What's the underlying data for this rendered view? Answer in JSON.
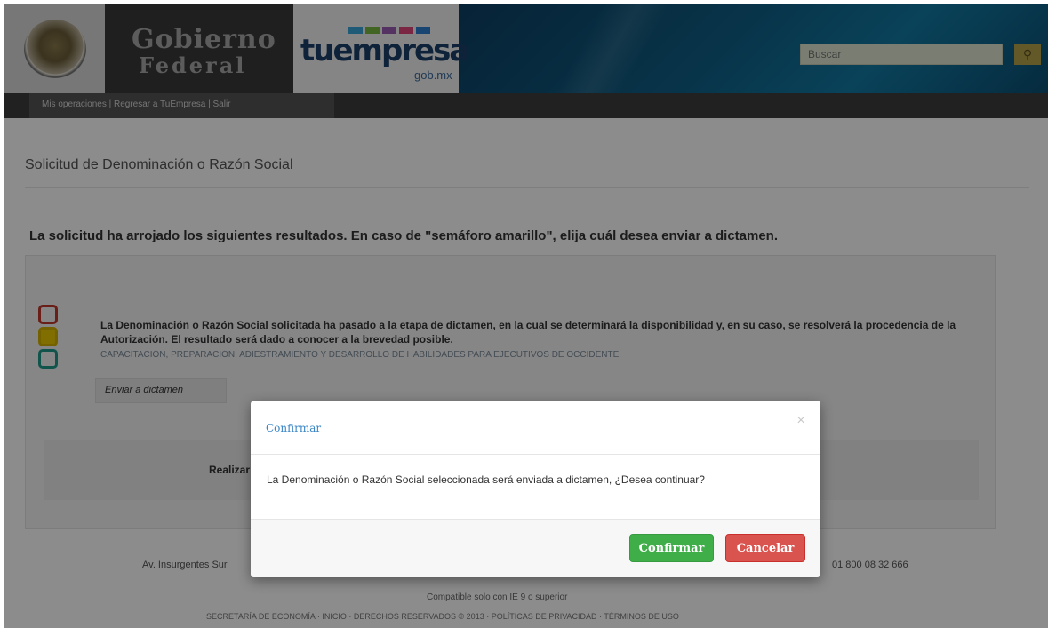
{
  "header": {
    "gobierno_line1": "Gobierno",
    "gobierno_line2": "Federal",
    "tuempresa_logo": "tuempresa",
    "tuempresa_sub": "gob.mx",
    "search_placeholder": "Buscar",
    "search_icon": "search-icon",
    "emblem_icon": "mexico-emblem-icon"
  },
  "nav": {
    "links": "Mis operaciones | Regresar a TuEmpresa | Salir"
  },
  "page": {
    "title": "Solicitud de Denominación o Razón Social",
    "heading": "La solicitud ha arrojado los siguientes resultados. En caso de \"semáforo amarillo\", elija cuál desea enviar a dictamen."
  },
  "result": {
    "message": "La Denominación o Razón Social solicitada ha pasado a la etapa de dictamen, en la cual se determinará la disponibilidad y, en su caso, se resolverá la procedencia de la Autorización. El resultado será dado a conocer a la brevedad posible.",
    "name": "CAPACITACIÓN, PREPARACIÓN, ADIESTRAMIENTO Y DESARROLLO DE HABILIDADES PARA EJECUTIVOS DE OCCIDENTE",
    "send_link": "Enviar a dictamen",
    "sub_label": "Realizar"
  },
  "footer": {
    "address": "Av. Insurgentes Sur",
    "phone": "01 800 08 32 666",
    "compat": "Compatible solo con IE 9 o superior",
    "links": "SECRETARÍA DE ECONOMÍA · INICIO · DERECHOS RESERVADOS © 2013 · POLÍTICAS DE PRIVACIDAD · TÉRMINOS DE USO"
  },
  "modal": {
    "title": "Confirmar",
    "close_icon": "×",
    "message": "La Denominación o Razón Social seleccionada será enviada a dictamen, ¿Desea continuar?",
    "confirm_label": "Confirmar",
    "cancel_label": "Cancelar"
  },
  "colors": {
    "confirm": "#3fae49",
    "cancel": "#d9534f",
    "modal_title": "#3a86c6",
    "semaforo_red": "#c0392b",
    "semaforo_yellow": "#e9c900",
    "semaforo_green": "#1f9a8a"
  }
}
